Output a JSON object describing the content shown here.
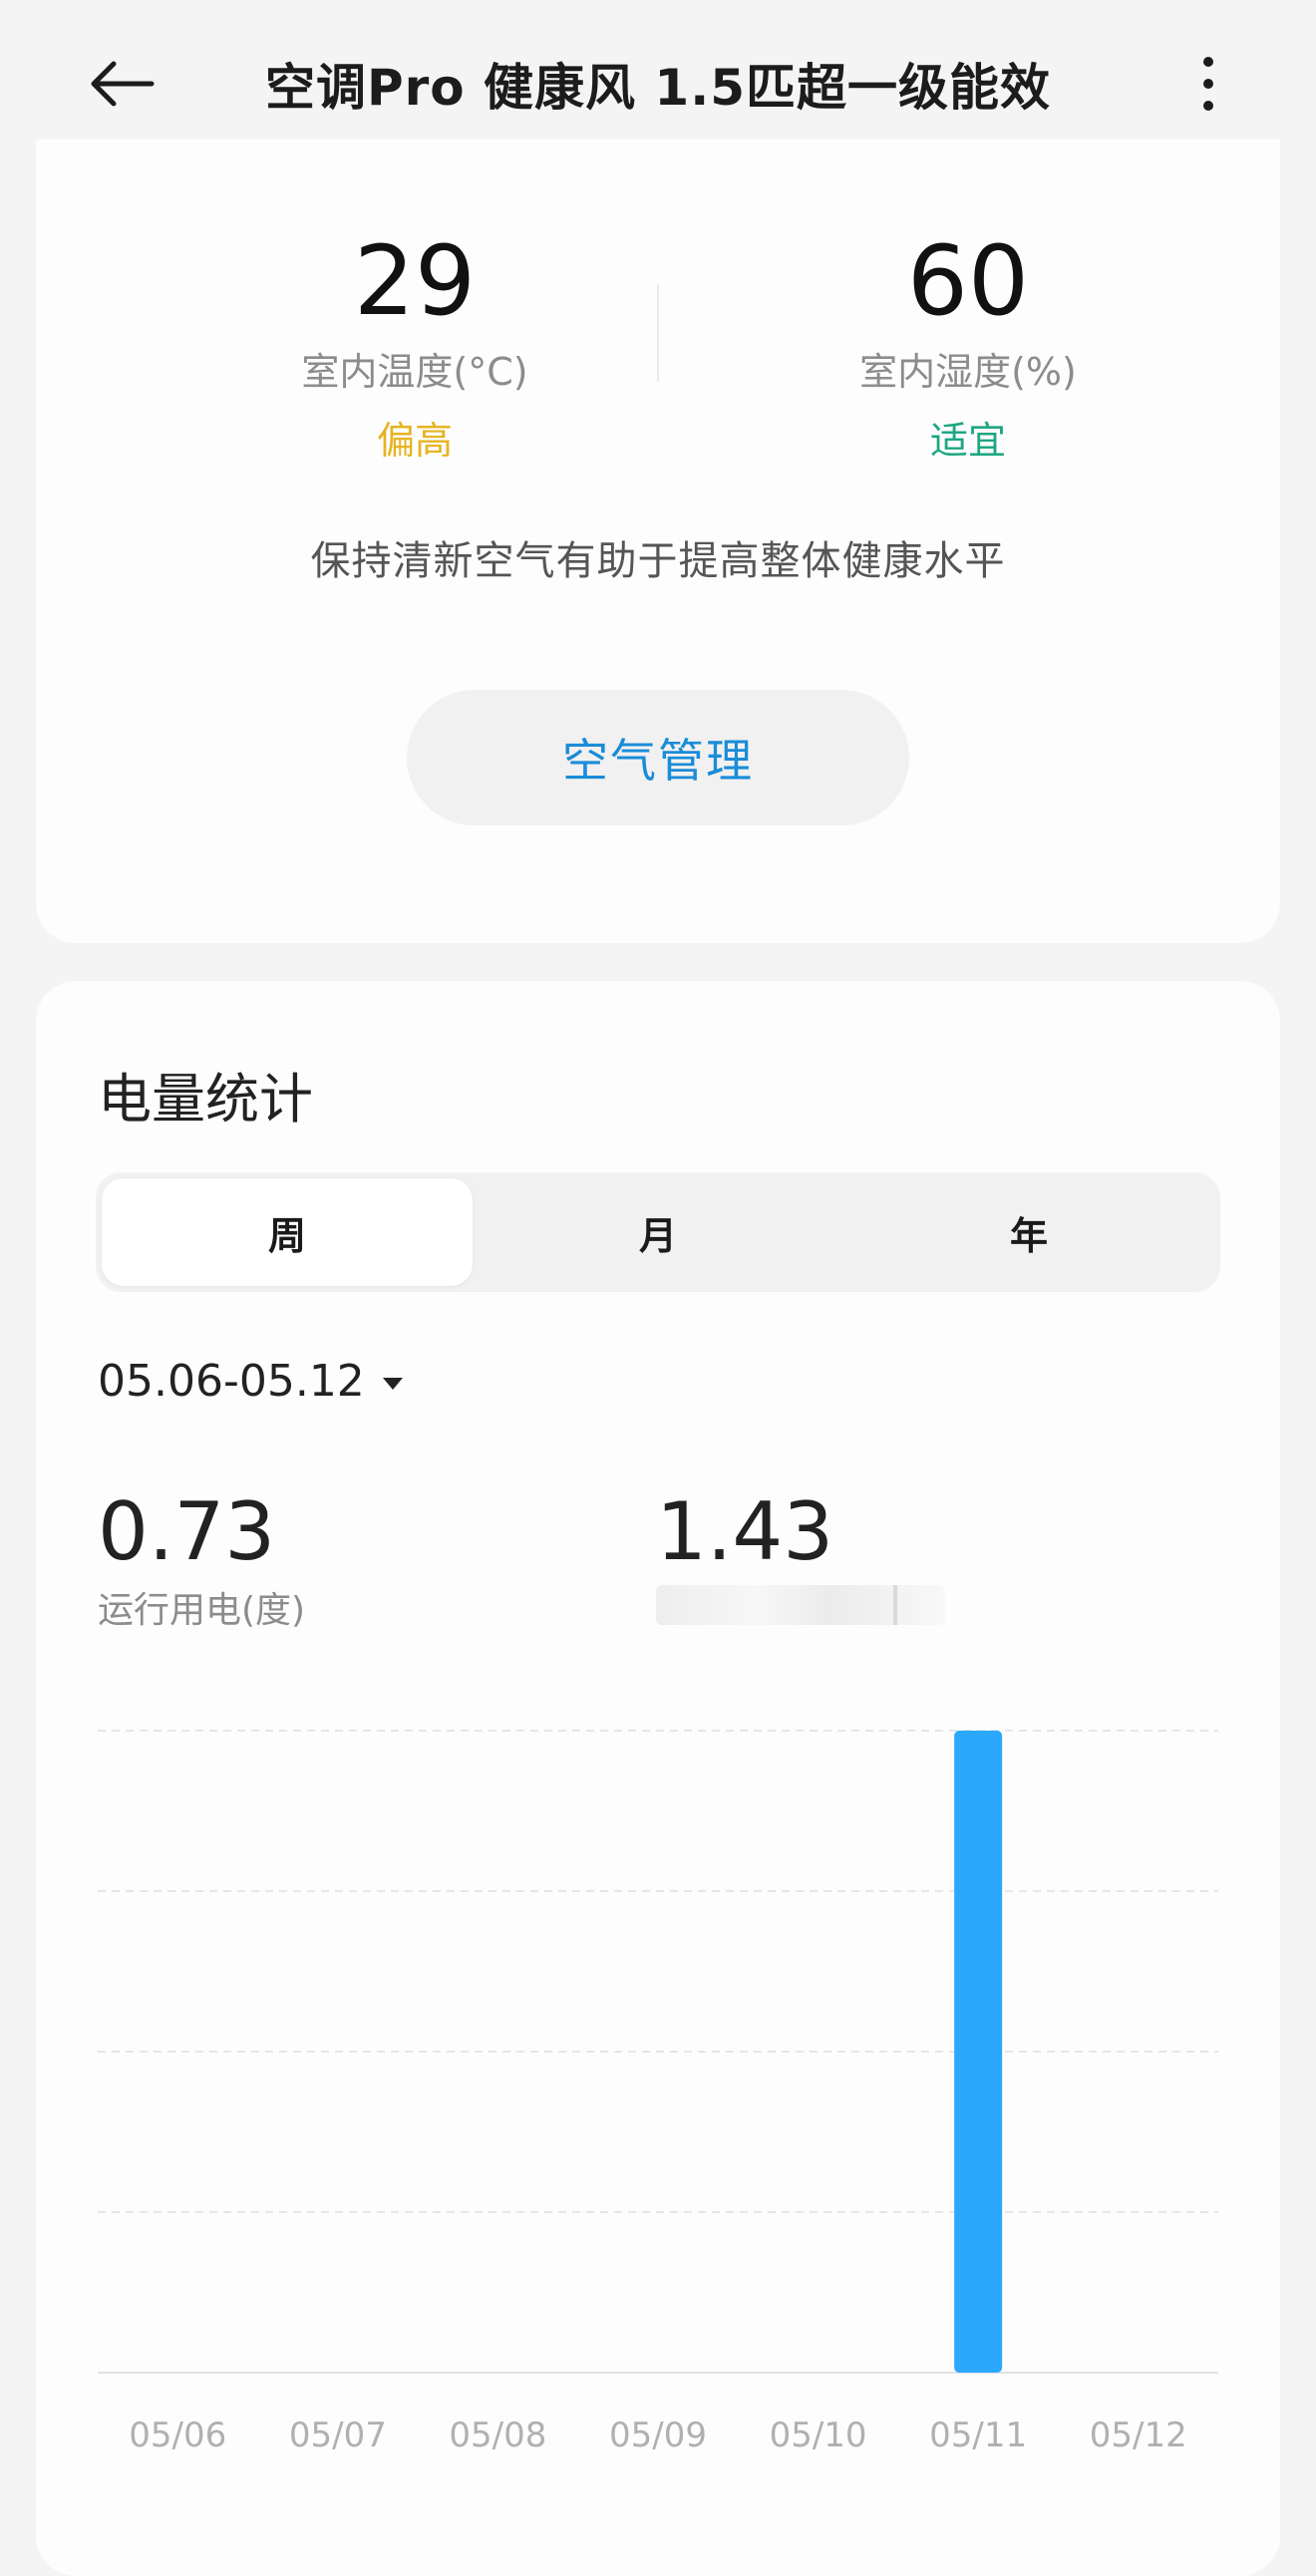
{
  "header": {
    "title": "空调Pro 健康风 1.5匹超一级能效",
    "back_icon": "arrow-left-icon",
    "more_icon": "vertical-dots-icon"
  },
  "environment": {
    "temperature": {
      "value": "29",
      "label": "室内温度(°C)",
      "status": "偏高",
      "status_color": "#e6b422"
    },
    "humidity": {
      "value": "60",
      "label": "室内湿度(%)",
      "status": "适宜",
      "status_color": "#1ea682"
    },
    "tip": "保持清新空气有助于提高整体健康水平",
    "air_button": "空气管理"
  },
  "power": {
    "title": "电量统计",
    "tabs": [
      {
        "label": "周",
        "active": true
      },
      {
        "label": "月",
        "active": false
      },
      {
        "label": "年",
        "active": false
      }
    ],
    "date_range": "05.06-05.12",
    "run_value": "0.73",
    "run_label": "运行用电(度)",
    "total_value": "1.43"
  },
  "chart_data": {
    "type": "bar",
    "categories": [
      "05/06",
      "05/07",
      "05/08",
      "05/09",
      "05/10",
      "05/11",
      "05/12"
    ],
    "values": [
      0,
      0,
      0,
      0,
      0,
      1.43,
      0
    ],
    "ylim": [
      0,
      1.43
    ],
    "grid": true,
    "bar_color": "#2aa8fc"
  }
}
